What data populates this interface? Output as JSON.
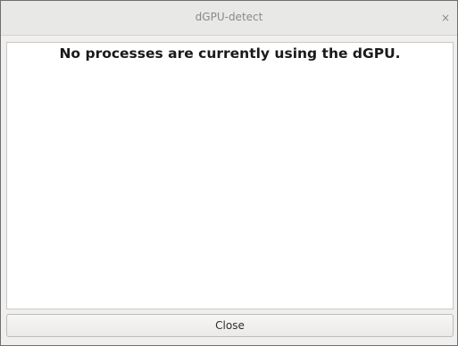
{
  "window": {
    "title": "dGPU-detect",
    "close_glyph": "×"
  },
  "content": {
    "message": "No processes are currently using the dGPU."
  },
  "footer": {
    "close_label": "Close"
  }
}
